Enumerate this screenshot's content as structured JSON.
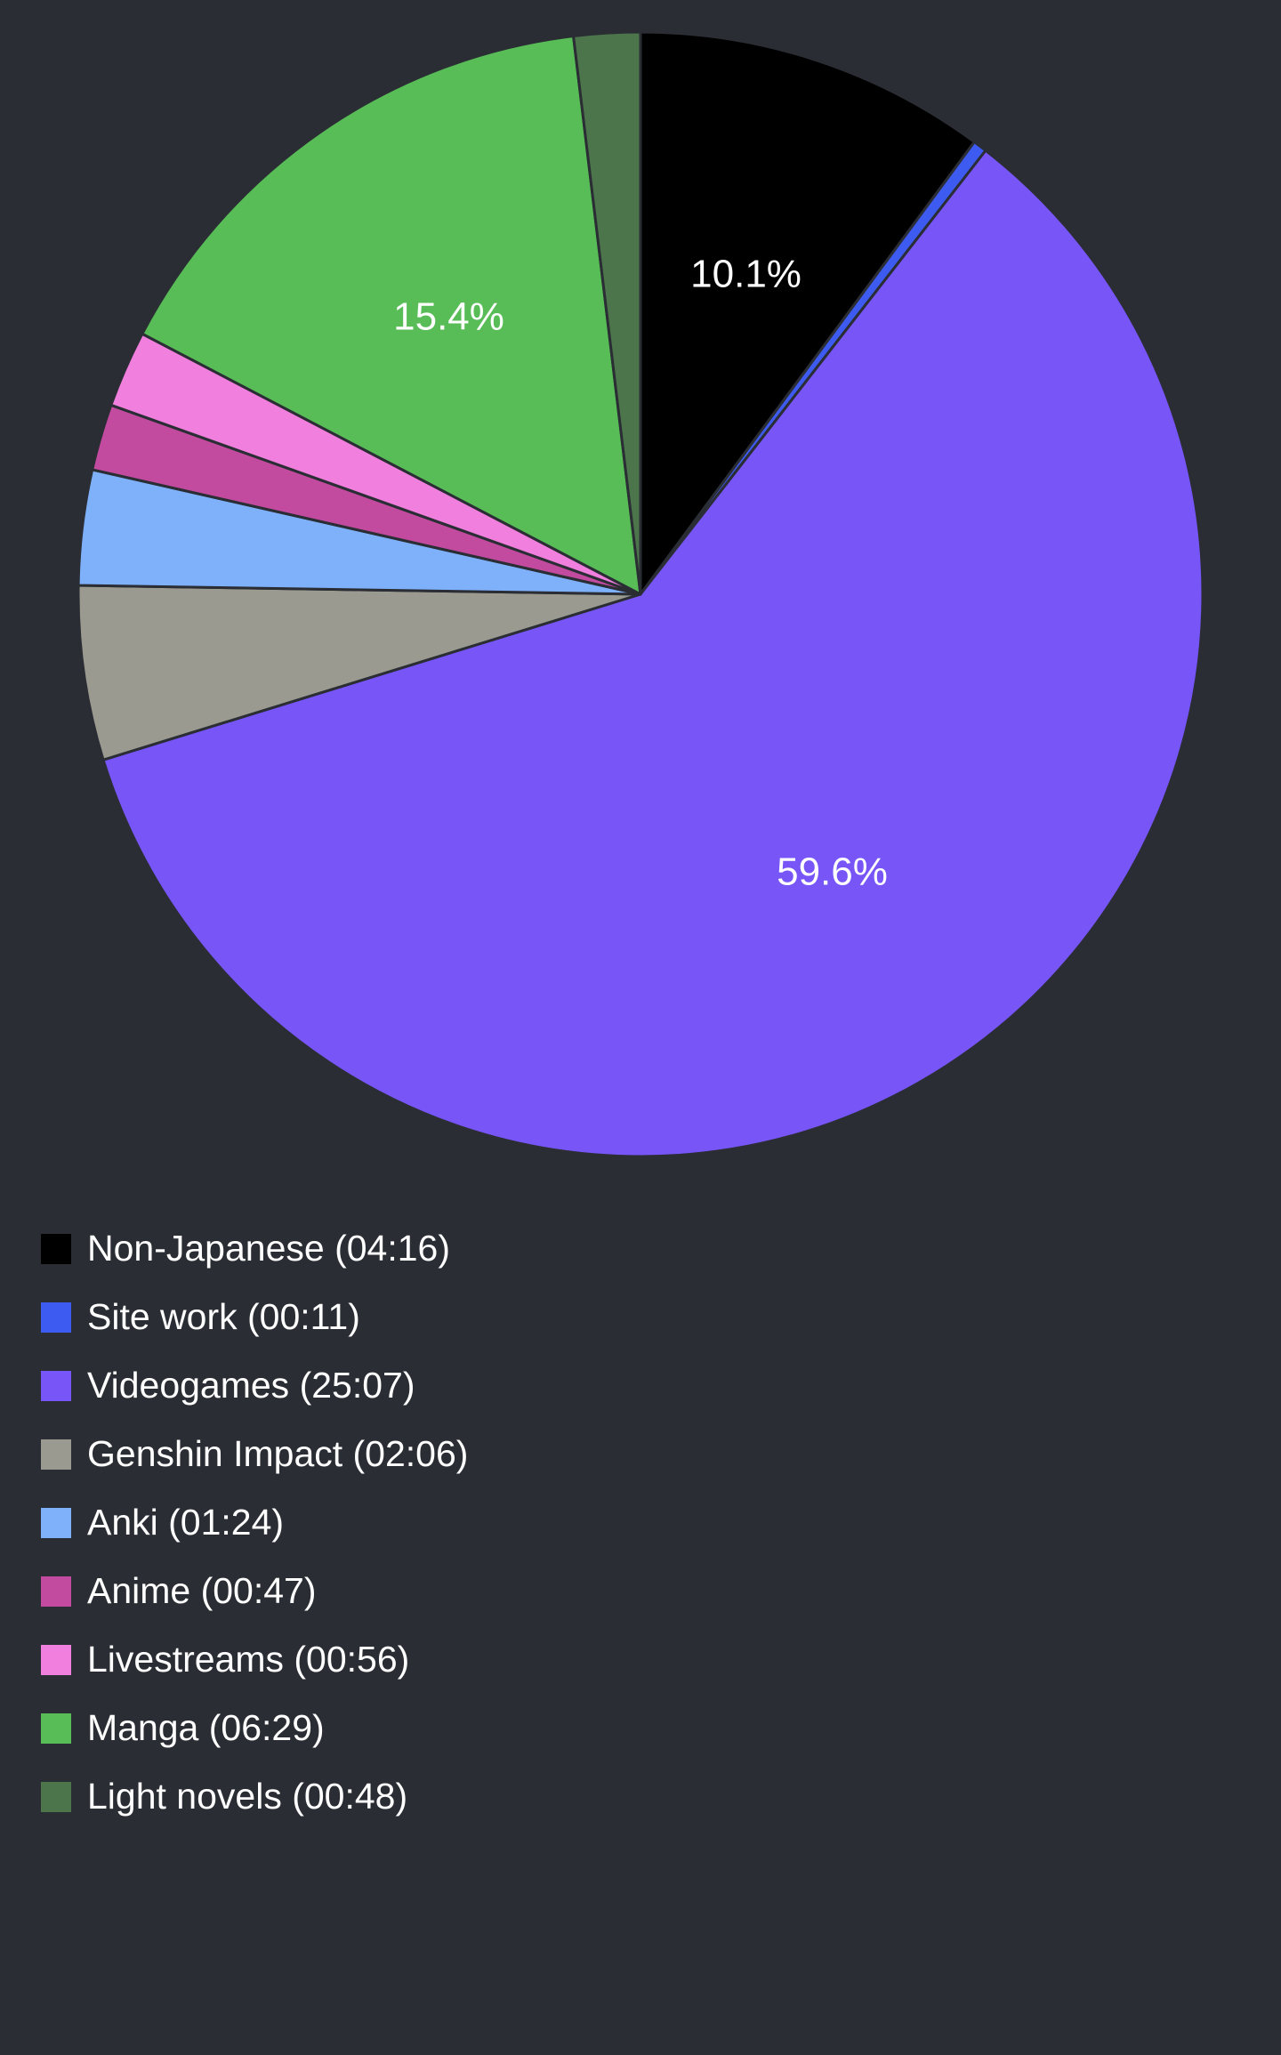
{
  "chart_data": {
    "type": "pie",
    "slices": [
      {
        "label": "Non-Japanese (04:16)",
        "value": 10.1,
        "color": "#000000",
        "display_label": "10.1%"
      },
      {
        "label": "Site work (00:11)",
        "value": 0.4,
        "color": "#3d5af1",
        "display_label": ""
      },
      {
        "label": "Videogames (25:07)",
        "value": 59.6,
        "color": "#7755f7",
        "display_label": "59.6%"
      },
      {
        "label": "Genshin Impact (02:06)",
        "value": 5.0,
        "color": "#9a9a90",
        "display_label": ""
      },
      {
        "label": "Anki (01:24)",
        "value": 3.3,
        "color": "#7fb1fb",
        "display_label": ""
      },
      {
        "label": "Anime (00:47)",
        "value": 1.9,
        "color": "#c34b9f",
        "display_label": ""
      },
      {
        "label": "Livestreams (00:56)",
        "value": 2.2,
        "color": "#f17fdd",
        "display_label": ""
      },
      {
        "label": "Manga (06:29)",
        "value": 15.4,
        "color": "#58bc57",
        "display_label": "15.4%"
      },
      {
        "label": "Light novels (00:48)",
        "value": 1.9,
        "color": "#4d754c",
        "display_label": ""
      }
    ],
    "title": "",
    "legend_position": "bottom-left",
    "start_angle": "12 o'clock",
    "direction": "clockwise"
  }
}
